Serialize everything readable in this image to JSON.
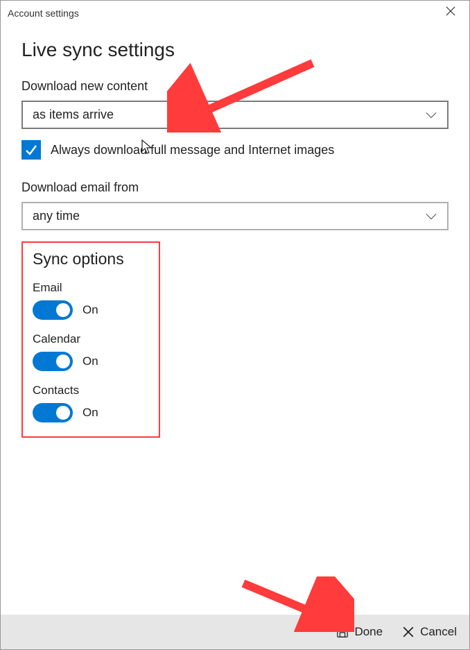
{
  "window": {
    "title": "Account settings"
  },
  "main": {
    "heading": "Live sync settings",
    "downloadContent": {
      "label": "Download new content",
      "value": "as items arrive"
    },
    "fullMessageCheckbox": {
      "checked": true,
      "label": "Always download full message and Internet images"
    },
    "downloadFrom": {
      "label": "Download email from",
      "value": "any time"
    },
    "syncOptions": {
      "heading": "Sync options",
      "items": [
        {
          "label": "Email",
          "state": "On",
          "on": true
        },
        {
          "label": "Calendar",
          "state": "On",
          "on": true
        },
        {
          "label": "Contacts",
          "state": "On",
          "on": true
        }
      ]
    }
  },
  "footer": {
    "done": "Done",
    "cancel": "Cancel"
  },
  "colors": {
    "accent": "#0078d4",
    "annotation": "#ff3b3b"
  }
}
